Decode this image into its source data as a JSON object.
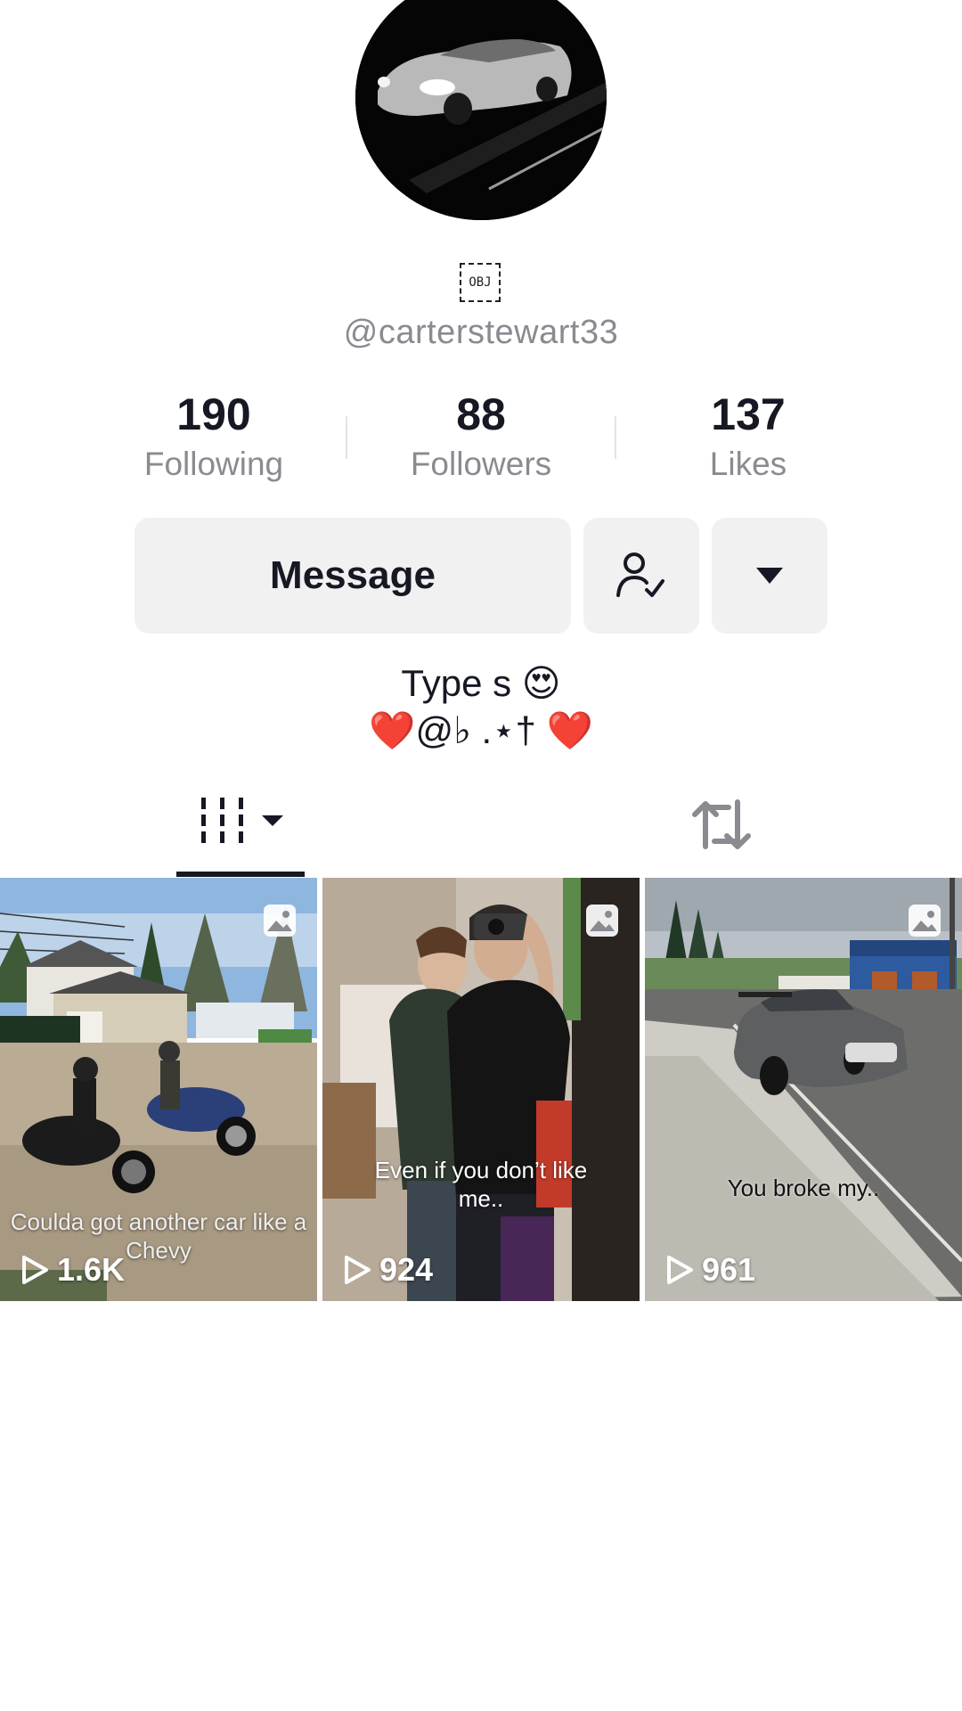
{
  "profile": {
    "obj_label": "OBJ",
    "username": "@carterstewart33"
  },
  "stats": [
    {
      "value": "190",
      "label": "Following"
    },
    {
      "value": "88",
      "label": "Followers"
    },
    {
      "value": "137",
      "label": "Likes"
    }
  ],
  "actions": {
    "message_label": "Message",
    "follow_icon": "user-check-icon",
    "more_icon": "caret-down-icon"
  },
  "bio": {
    "line1": "Type s",
    "line1_emoji": "😍",
    "line2_left_heart": "❤️",
    "line2_text": "@♭ .⋆†",
    "line2_right_heart": "❤️"
  },
  "tabs": {
    "videos_icon": "grid-icon",
    "reposts_icon": "repost-icon"
  },
  "videos": [
    {
      "caption": "Coulda got another car like a Chevy",
      "views": "1.6K",
      "type_icon": "photo-icon"
    },
    {
      "caption": "Even if you don’t like me..",
      "views": "924",
      "type_icon": "photo-icon"
    },
    {
      "caption": "You broke my..",
      "views": "961",
      "type_icon": "photo-icon"
    }
  ],
  "colors": {
    "heart": "#e8202e",
    "muted_text": "#8a8b91",
    "button_bg": "#f1f1f2",
    "primary_text": "#161823"
  }
}
